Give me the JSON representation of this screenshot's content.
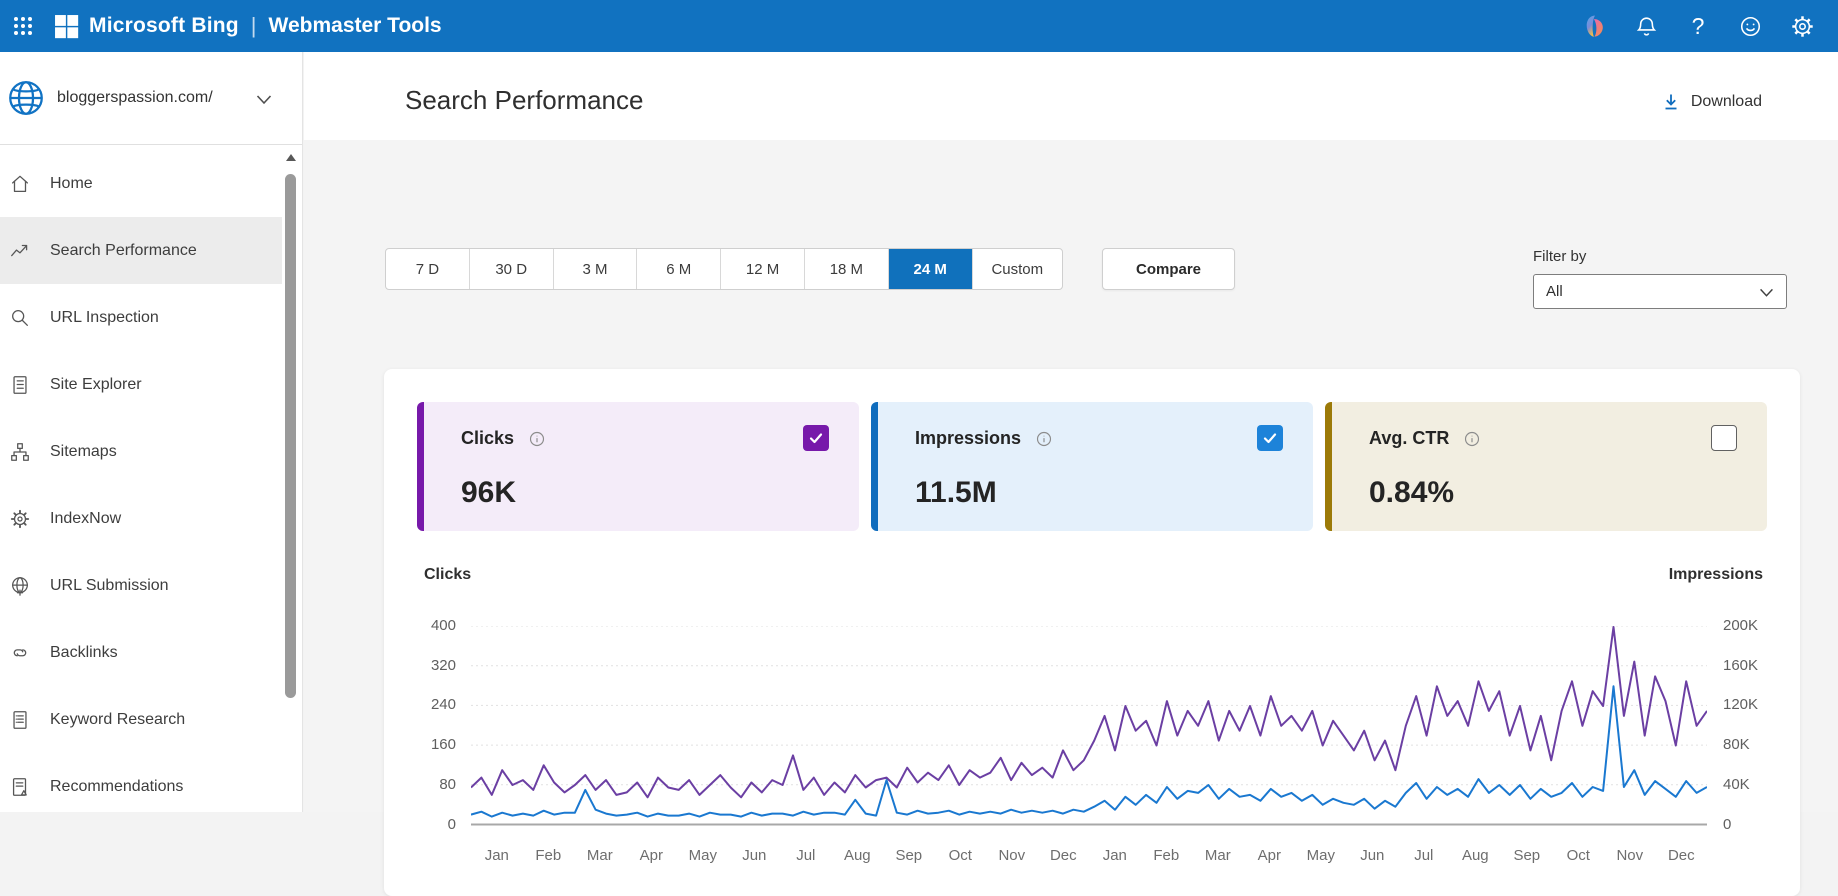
{
  "topbar": {
    "brand": "Microsoft Bing",
    "product": "Webmaster Tools",
    "icons": [
      "copilot",
      "notifications",
      "help",
      "feedback",
      "settings"
    ]
  },
  "sidebar": {
    "site": "bloggerspassion.com/",
    "items": [
      {
        "label": "Home",
        "icon": "home",
        "selected": false
      },
      {
        "label": "Search Performance",
        "icon": "trend",
        "selected": true
      },
      {
        "label": "URL Inspection",
        "icon": "magnifier",
        "selected": false
      },
      {
        "label": "Site Explorer",
        "icon": "site-explorer",
        "selected": false
      },
      {
        "label": "Sitemaps",
        "icon": "sitemap",
        "selected": false
      },
      {
        "label": "IndexNow",
        "icon": "indexnow",
        "selected": false
      },
      {
        "label": "URL Submission",
        "icon": "globe-plus",
        "selected": false
      },
      {
        "label": "Backlinks",
        "icon": "links",
        "selected": false
      },
      {
        "label": "Keyword Research",
        "icon": "doc-list",
        "selected": false
      },
      {
        "label": "Recommendations",
        "icon": "doc-alert",
        "selected": false
      }
    ]
  },
  "header": {
    "title": "Search Performance",
    "download": "Download"
  },
  "toolbar": {
    "ranges": [
      "7 D",
      "30 D",
      "3 M",
      "6 M",
      "12 M",
      "18 M",
      "24 M",
      "Custom"
    ],
    "selected": "24 M",
    "compare": "Compare",
    "filter_label": "Filter by",
    "filter_value": "All"
  },
  "cards": [
    {
      "title": "Clicks",
      "value": "96K",
      "checked": true,
      "accent": "#7719aa",
      "check_color": "#7719aa",
      "bg": "#f4ecf9"
    },
    {
      "title": "Impressions",
      "value": "11.5M",
      "checked": true,
      "accent": "#0f6cbd",
      "check_color": "#1d83d9",
      "bg": "#e4f0fb"
    },
    {
      "title": "Avg. CTR",
      "value": "0.84%",
      "checked": false,
      "accent": "#9c7a08",
      "check_color": "",
      "bg": "#f2eee1"
    }
  ],
  "chart_data": {
    "type": "line",
    "grid": "horizontal-dotted",
    "left_axis": {
      "label": "Clicks",
      "range": [
        0,
        400
      ],
      "tick_labels": [
        "0",
        "80",
        "160",
        "240",
        "320",
        "400"
      ]
    },
    "right_axis": {
      "label": "Impressions",
      "range": [
        0,
        200000
      ],
      "tick_labels": [
        "0",
        "40K",
        "80K",
        "120K",
        "160K",
        "200K"
      ]
    },
    "x_labels": [
      "Jan",
      "Feb",
      "Mar",
      "Apr",
      "May",
      "Jun",
      "Jul",
      "Aug",
      "Sep",
      "Oct",
      "Nov",
      "Dec",
      "Jan",
      "Feb",
      "Mar",
      "Apr",
      "May",
      "Jun",
      "Jul",
      "Aug",
      "Sep",
      "Oct",
      "Nov",
      "Dec"
    ],
    "series": [
      {
        "name": "Clicks",
        "axis": "left",
        "color": "#6b3fa3",
        "max": 400,
        "values": [
          75,
          95,
          60,
          110,
          80,
          90,
          70,
          120,
          85,
          65,
          80,
          100,
          70,
          90,
          60,
          65,
          85,
          55,
          95,
          75,
          70,
          90,
          60,
          80,
          100,
          75,
          55,
          85,
          65,
          90,
          80,
          140,
          70,
          95,
          60,
          85,
          65,
          100,
          75,
          90,
          95,
          75,
          115,
          85,
          105,
          90,
          120,
          80,
          110,
          95,
          105,
          135,
          90,
          125,
          100,
          115,
          95,
          150,
          110,
          130,
          170,
          220,
          150,
          240,
          190,
          210,
          160,
          250,
          180,
          230,
          200,
          250,
          170,
          230,
          190,
          240,
          180,
          260,
          200,
          220,
          190,
          230,
          160,
          210,
          180,
          150,
          190,
          130,
          170,
          110,
          200,
          260,
          180,
          280,
          220,
          250,
          200,
          290,
          230,
          270,
          180,
          240,
          150,
          220,
          130,
          230,
          290,
          200,
          270,
          240,
          400,
          220,
          330,
          180,
          300,
          250,
          160,
          290,
          200,
          230
        ]
      },
      {
        "name": "Impressions",
        "axis": "right",
        "color": "#1a78d0",
        "max": 200,
        "unit": "thousands",
        "values": [
          10,
          13,
          8,
          12,
          9,
          11,
          9,
          14,
          10,
          12,
          12,
          35,
          15,
          11,
          9,
          10,
          12,
          8,
          11,
          9,
          9,
          11,
          8,
          12,
          10,
          10,
          8,
          12,
          9,
          11,
          11,
          9,
          13,
          10,
          12,
          12,
          10,
          25,
          11,
          9,
          45,
          12,
          10,
          14,
          11,
          12,
          14,
          10,
          13,
          11,
          13,
          11,
          15,
          12,
          14,
          12,
          14,
          11,
          15,
          13,
          18,
          24,
          15,
          28,
          20,
          30,
          22,
          38,
          26,
          34,
          32,
          40,
          26,
          36,
          28,
          30,
          24,
          36,
          28,
          32,
          24,
          30,
          20,
          26,
          22,
          20,
          26,
          16,
          24,
          18,
          32,
          42,
          26,
          38,
          30,
          36,
          28,
          46,
          32,
          40,
          30,
          40,
          26,
          36,
          28,
          32,
          42,
          28,
          38,
          34,
          140,
          38,
          55,
          30,
          44,
          36,
          28,
          44,
          32,
          38
        ]
      }
    ]
  }
}
